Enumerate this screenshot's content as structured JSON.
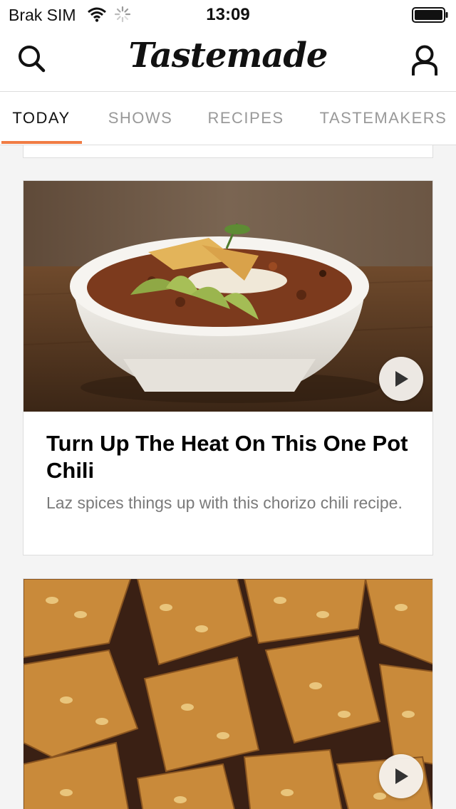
{
  "status_bar": {
    "carrier": "Brak SIM",
    "time": "13:09",
    "icons": [
      "wifi-icon",
      "spinner-icon",
      "battery-icon"
    ]
  },
  "nav": {
    "logo": "Tastemade",
    "left_icon": "search-icon",
    "right_icon": "profile-icon"
  },
  "tabs": [
    {
      "label": "TODAY",
      "active": true
    },
    {
      "label": "SHOWS",
      "active": false
    },
    {
      "label": "RECIPES",
      "active": false
    },
    {
      "label": "TASTEMAKERS",
      "active": false
    }
  ],
  "colors": {
    "accent": "#f07c44",
    "background": "#f4f4f4",
    "muted_text": "#7a7a7a"
  },
  "cards": [
    {
      "image": "bowl-of-chili-with-avocado-and-tortilla-strips",
      "title": "Turn Up The Heat On This One Pot Chili",
      "description": "Laz spices things up with this chorizo chili recipe.",
      "action_icon": "play-icon"
    },
    {
      "image": "pine-nut-brittle-pieces",
      "action_icon": "play-icon"
    }
  ]
}
